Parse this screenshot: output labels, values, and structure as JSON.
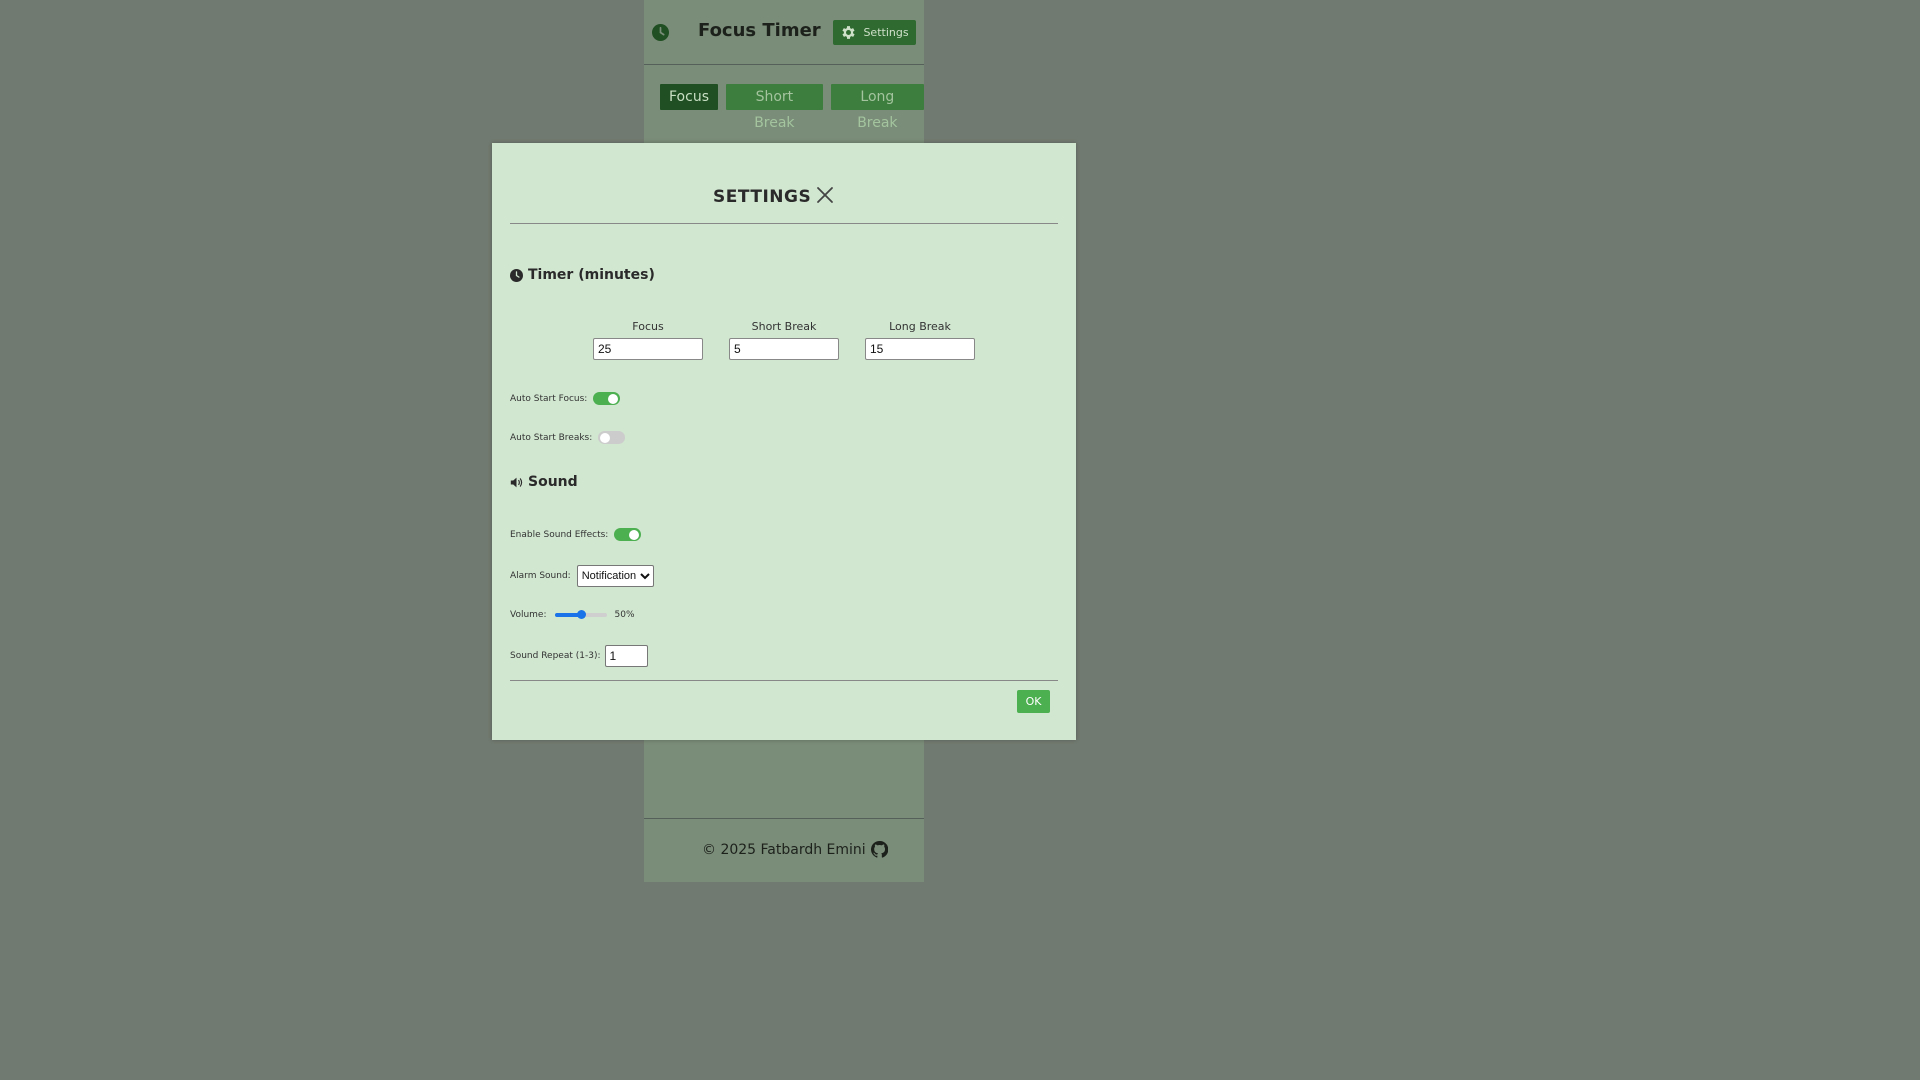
{
  "app": {
    "title": "Focus Timer",
    "settings_label": "Settings",
    "tabs": [
      {
        "label": "Focus",
        "active": true
      },
      {
        "label": "Short Break",
        "active": false
      },
      {
        "label": "Long Break",
        "active": false
      }
    ],
    "footer": "© 2025 Fatbardh Emini"
  },
  "modal": {
    "title": "SETTINGS",
    "timer_section": "Timer (minutes)",
    "durations": [
      {
        "label": "Focus",
        "value": "25"
      },
      {
        "label": "Short Break",
        "value": "5"
      },
      {
        "label": "Long Break",
        "value": "15"
      }
    ],
    "auto_start_focus": {
      "label": "Auto Start Focus:",
      "on": true
    },
    "auto_start_breaks": {
      "label": "Auto Start Breaks:",
      "on": false
    },
    "sound_section": "Sound",
    "enable_sound": {
      "label": "Enable Sound Effects:",
      "on": true
    },
    "alarm": {
      "label": "Alarm Sound:",
      "selected": "Notification"
    },
    "volume": {
      "label": "Volume:",
      "value": 50,
      "text": "50%"
    },
    "repeat": {
      "label": "Sound Repeat (1-3):",
      "value": "1"
    },
    "ok_label": "OK"
  },
  "colors": {
    "accent": "#4caf50",
    "tab_active": "#1f4f22",
    "tab_inactive": "#3d7d3d",
    "modal_bg": "#d1e7d0",
    "slider": "#1a73e8"
  }
}
